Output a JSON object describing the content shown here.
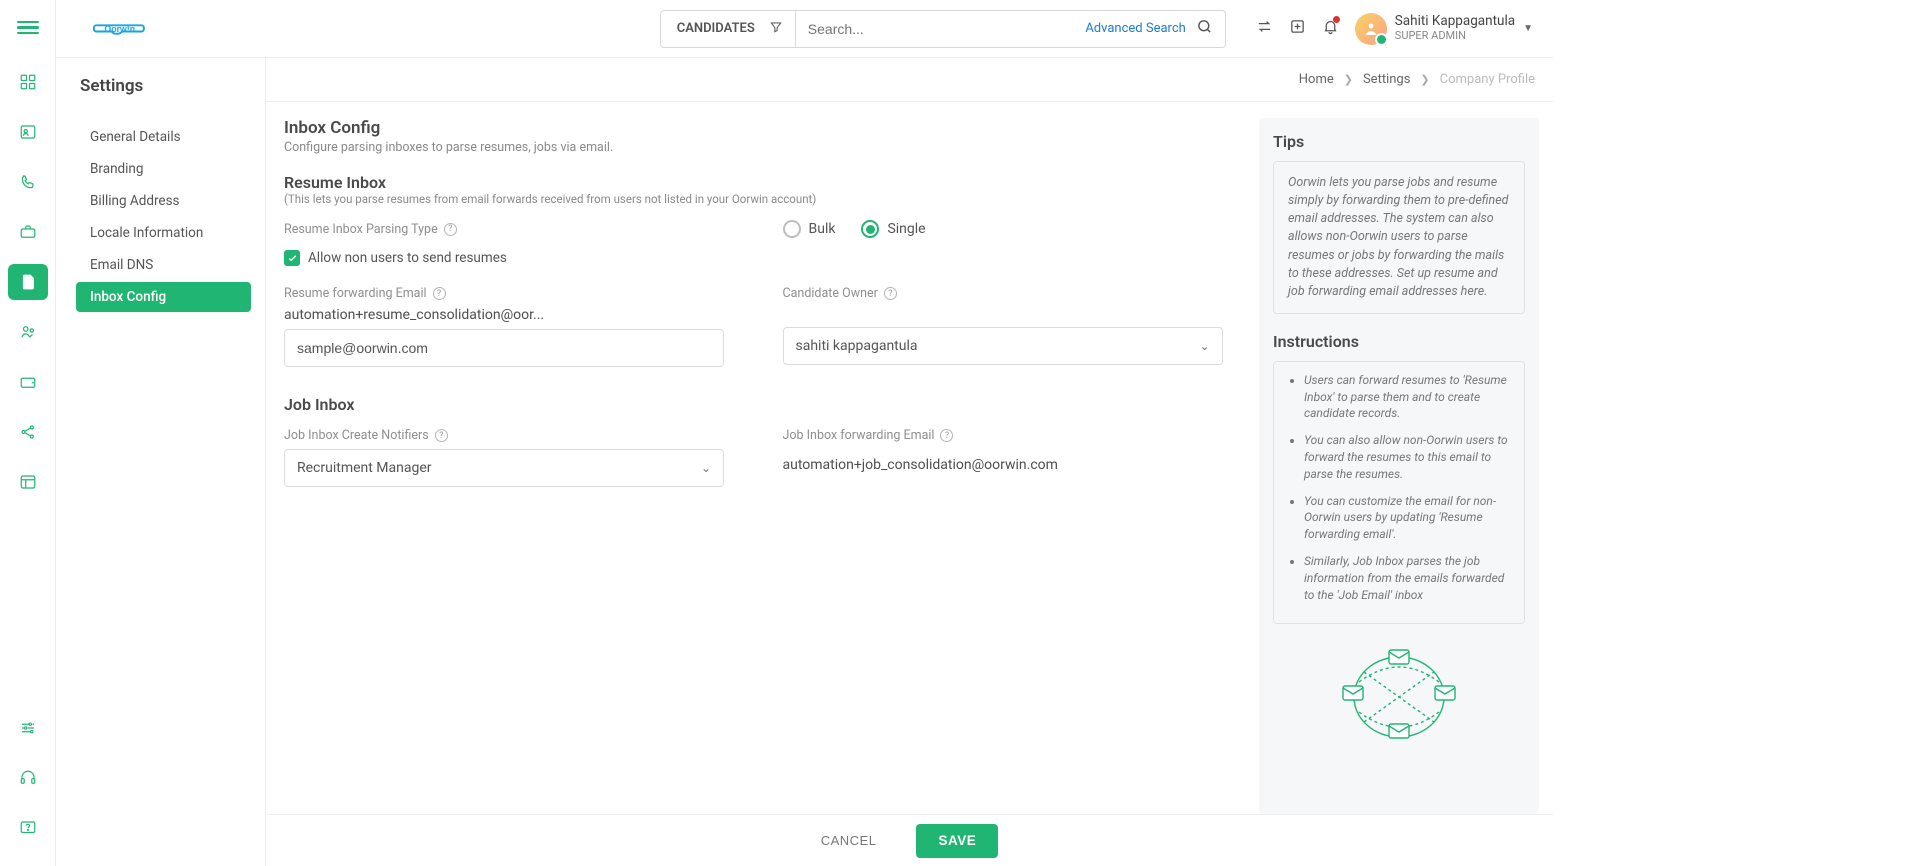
{
  "brand": {
    "name": "Oorwin"
  },
  "header": {
    "candidates_label": "CANDIDATES",
    "search_placeholder": "Search...",
    "advanced_search": "Advanced Search",
    "user_name": "Sahiti Kappagantula",
    "user_role": "SUPER ADMIN"
  },
  "breadcrumbs": {
    "home": "Home",
    "settings": "Settings",
    "current": "Company Profile"
  },
  "settings": {
    "title": "Settings",
    "items": [
      "General Details",
      "Branding",
      "Billing Address",
      "Locale Information",
      "Email DNS",
      "Inbox Config"
    ],
    "active_index": 5
  },
  "form": {
    "inbox_config_title": "Inbox Config",
    "inbox_config_sub": "Configure parsing inboxes to parse resumes, jobs via email.",
    "resume_inbox_title": "Resume Inbox",
    "resume_inbox_sub": "(This lets you parse resumes from email forwards received from users not listed in your Oorwin account)",
    "parse_type_label": "Resume Inbox Parsing Type",
    "bulk_label": "Bulk",
    "single_label": "Single",
    "parse_type_selected": "single",
    "allow_non_users_label": "Allow non users to send resumes",
    "allow_non_users_checked": true,
    "resume_fwd_label": "Resume forwarding Email",
    "resume_fwd_value": "automation+resume_consolidation@oor...",
    "resume_fwd_input_value": "sample@oorwin.com",
    "candidate_owner_label": "Candidate Owner",
    "candidate_owner_value": "sahiti kappagantula",
    "job_inbox_title": "Job Inbox",
    "job_notifiers_label": "Job Inbox Create Notifiers",
    "job_notifiers_value": "Recruitment Manager",
    "job_fwd_label": "Job Inbox forwarding Email",
    "job_fwd_value": "automation+job_consolidation@oorwin.com",
    "cancel_label": "CANCEL",
    "save_label": "SAVE"
  },
  "tips": {
    "title": "Tips",
    "body": "Oorwin lets you parse jobs and resume simply by forwarding them to pre-defined email addresses. The system can also allows non-Oorwin users to parse resumes or jobs by forwarding the mails to these addresses. Set up resume and job forwarding email addresses here.",
    "instructions_title": "Instructions",
    "instructions": [
      "Users can forward resumes to 'Resume Inbox' to parse them and to create candidate records.",
      "You can also allow non-Oorwin users to forward the resumes to this email to parse the resumes.",
      "You can customize the email for non-Oorwin users by updating 'Resume forwarding email'.",
      "Similarly, Job Inbox parses the job information from the emails forwarded to the 'Job Email' inbox"
    ]
  },
  "colors": {
    "accent": "#21b573"
  }
}
